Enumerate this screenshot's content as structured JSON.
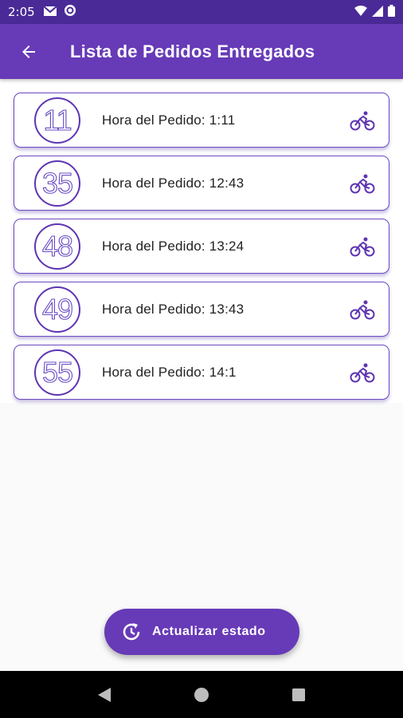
{
  "status_bar": {
    "time": "2:05"
  },
  "app_bar": {
    "title": "Lista de Pedidos Entregados"
  },
  "orders": [
    {
      "number": "11",
      "text": "Hora del Pedido: 1:11"
    },
    {
      "number": "35",
      "text": "Hora del Pedido: 12:43"
    },
    {
      "number": "48",
      "text": "Hora del Pedido: 13:24"
    },
    {
      "number": "49",
      "text": "Hora del Pedido: 13:43"
    },
    {
      "number": "55",
      "text": "Hora del Pedido: 14:1"
    }
  ],
  "fab": {
    "label": "Actualizar estado",
    "icon": "refresh-clock-icon"
  },
  "icons": {
    "order_status": "bicycle-icon",
    "back": "arrow-back-icon"
  },
  "colors": {
    "primary": "#673ab7",
    "primary_dark": "#4a2a97",
    "accent": "#5e35b1"
  }
}
